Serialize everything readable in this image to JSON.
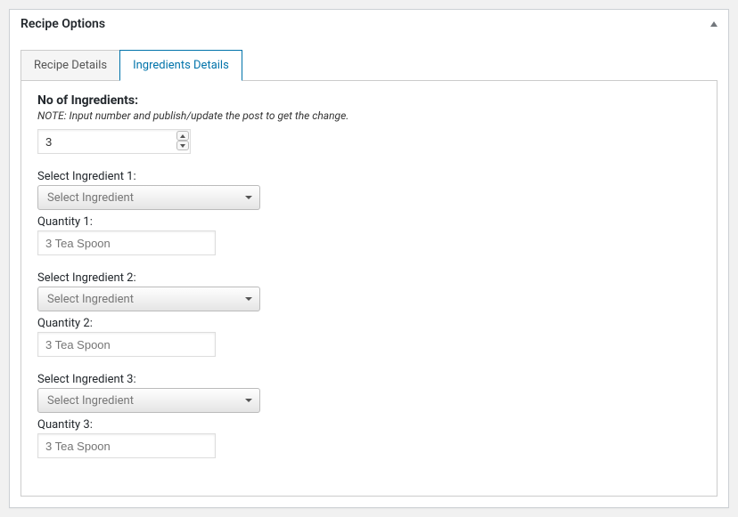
{
  "header": {
    "title": "Recipe Options"
  },
  "tabs": {
    "inactive": "Recipe Details",
    "active": "Ingredients Details"
  },
  "panel": {
    "section_title": "No of Ingredients:",
    "note": "NOTE: Input number and publish/update the post to get the change.",
    "count_value": "3",
    "ingredients": [
      {
        "select_label": "Select Ingredient 1:",
        "select_placeholder": "Select Ingredient",
        "qty_label": "Quantity 1:",
        "qty_placeholder": "3 Tea Spoon"
      },
      {
        "select_label": "Select Ingredient 2:",
        "select_placeholder": "Select Ingredient",
        "qty_label": "Quantity 2:",
        "qty_placeholder": "3 Tea Spoon"
      },
      {
        "select_label": "Select Ingredient 3:",
        "select_placeholder": "Select Ingredient",
        "qty_label": "Quantity 3:",
        "qty_placeholder": "3 Tea Spoon"
      }
    ]
  }
}
